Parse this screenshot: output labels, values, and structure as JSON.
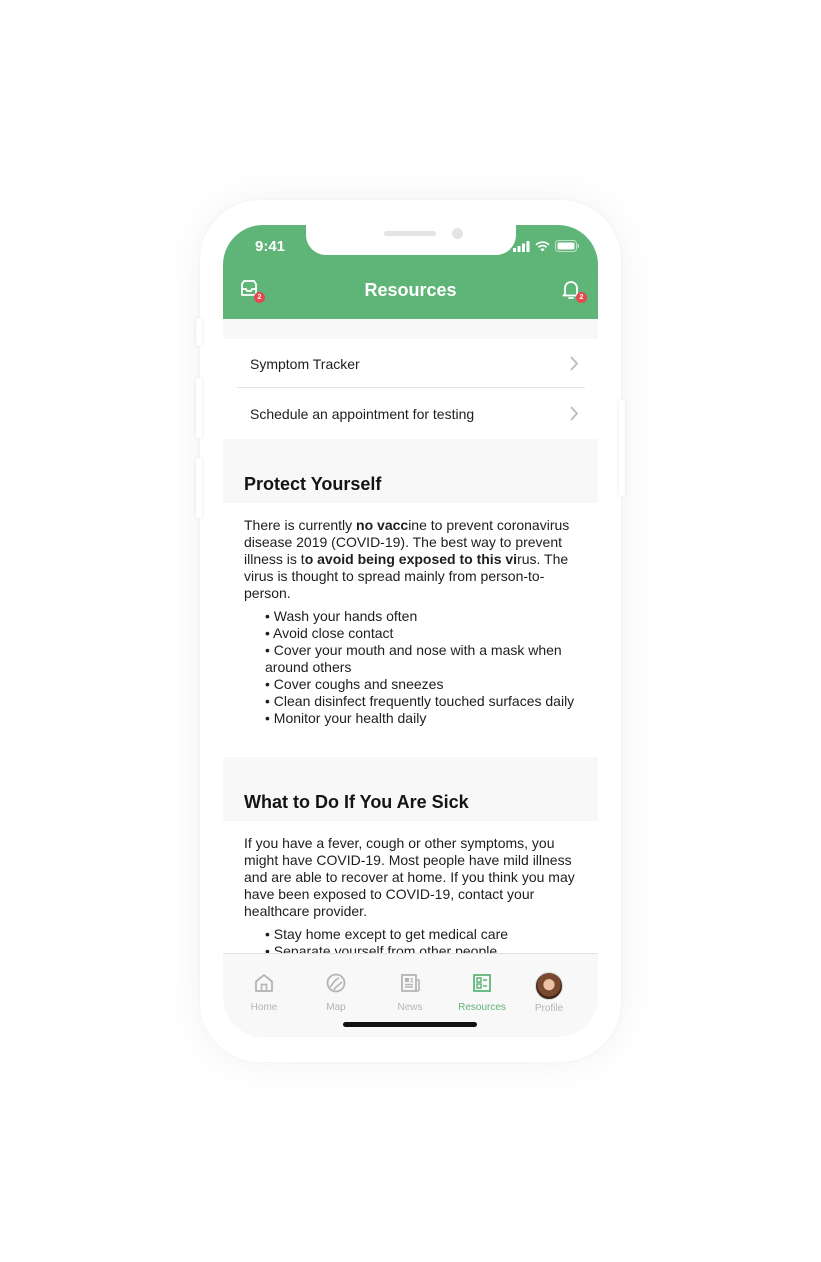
{
  "status_bar": {
    "time": "9:41"
  },
  "header": {
    "title": "Resources",
    "inbox_badge": "2",
    "bell_badge": "2",
    "background_color": "#5fb578"
  },
  "links": [
    {
      "label": "Symptom Tracker"
    },
    {
      "label": "Schedule an appointment for testing"
    }
  ],
  "protect": {
    "title": "Protect Yourself",
    "p1": "There is currently ",
    "b1": "no vacc",
    "p2": "ine to prevent coronavirus disease 2019 (COVID-19). The best way to prevent illness is t",
    "b2": "o avoid being exposed to this vi",
    "p3": "rus. The virus is thought to spread mainly from person-to-person.",
    "bullets": [
      "• Wash your hands often",
      "• Avoid close contact",
      "• Cover your mouth and nose with a mask when around others",
      "• Cover coughs and sneezes",
      "• Clean disinfect frequently touched surfaces daily",
      "• Monitor your health daily"
    ]
  },
  "sick": {
    "title": "What to Do If You Are Sick",
    "paragraph": "If you have a fever, cough or other symptoms, you might have COVID-19. Most people have mild illness and are able to recover at home. If you think you may have been exposed to COVID-19, contact your healthcare provider.",
    "bullets": [
      "• Stay home except to get medical care",
      "• Separate yourself from other people"
    ]
  },
  "tabs": [
    {
      "label": "Home",
      "icon": "home-icon",
      "active": false
    },
    {
      "label": "Map",
      "icon": "map-icon",
      "active": false
    },
    {
      "label": "News",
      "icon": "news-icon",
      "active": false
    },
    {
      "label": "Resources",
      "icon": "resources-icon",
      "active": true
    },
    {
      "label": "Profile",
      "icon": "avatar",
      "active": false
    }
  ],
  "colors": {
    "accent": "#5fb578",
    "badge": "#e5484d",
    "inactive_tab": "#b4b4b4"
  }
}
